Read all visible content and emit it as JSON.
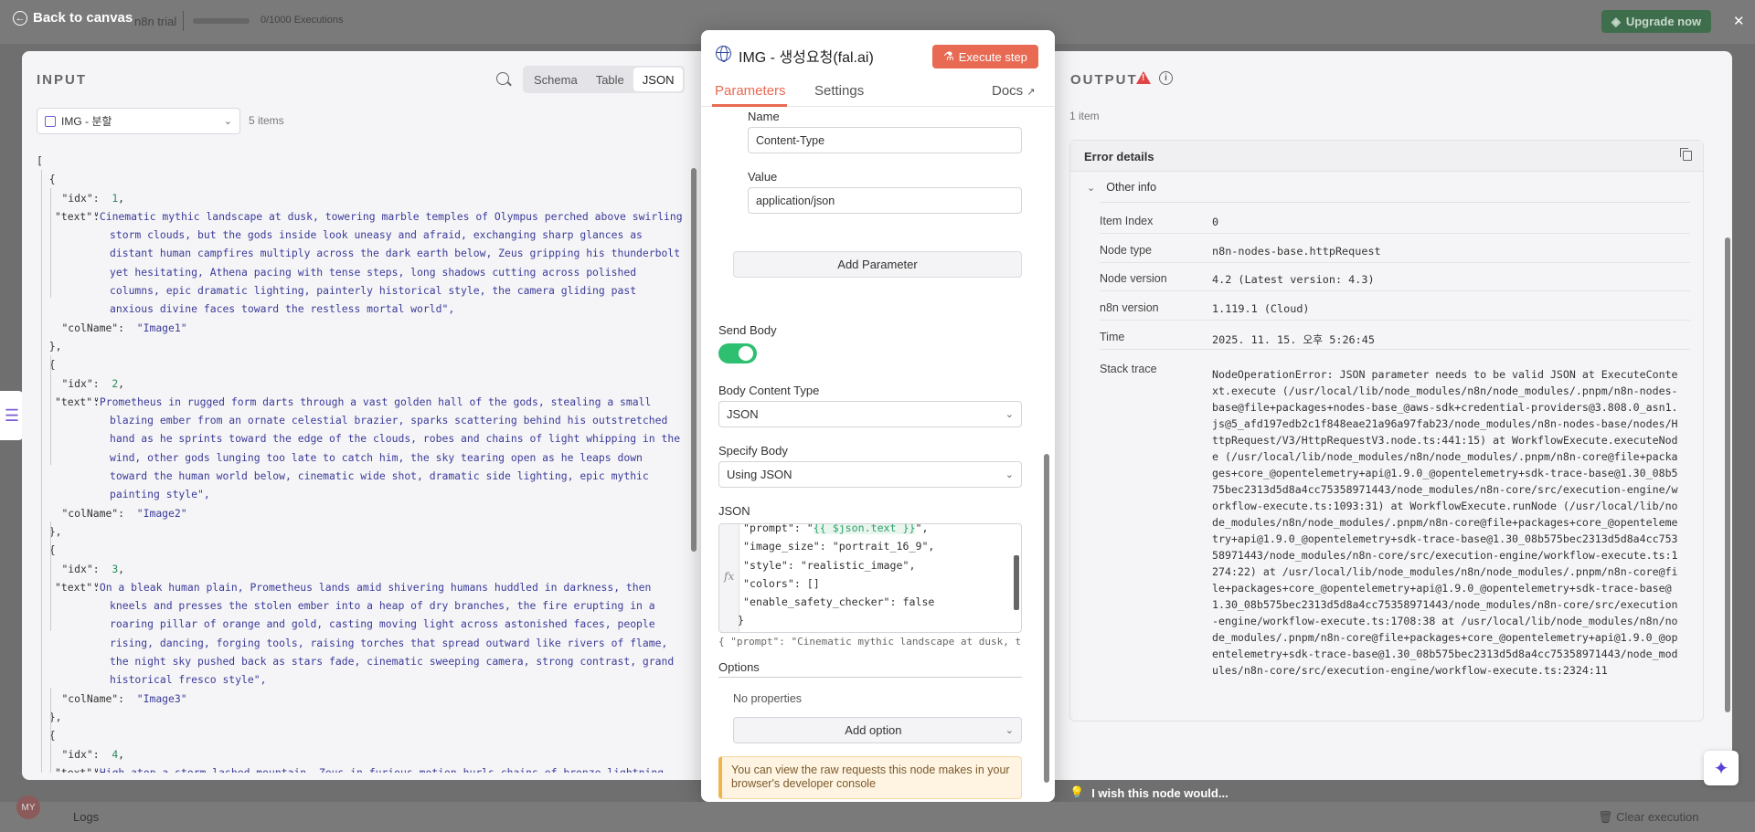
{
  "topbar": {
    "back_label": "Back to canvas",
    "trial_label": "n8n trial",
    "executions": "0/1000 Executions",
    "upgrade_label": "Upgrade now"
  },
  "bottombar": {
    "logs_label": "Logs",
    "clear_label": "Clear execution",
    "avatar_initials": "MY"
  },
  "input": {
    "title": "INPUT",
    "view_tabs": [
      "Schema",
      "Table",
      "JSON"
    ],
    "active_view": "JSON",
    "source_node": "IMG - 분할",
    "items_count": "5 items",
    "items": [
      {
        "idx": "1",
        "text": "\"Cinematic mythic landscape at dusk, towering marble temples of Olympus perched above swirling storm clouds, but the gods inside look uneasy and afraid, exchanging sharp glances as distant human campfires multiply across the dark earth below, Zeus gripping his thunderbolt yet hesitating, Athena pacing with tense steps, long shadows cutting across polished columns, epic dramatic lighting, painterly historical style, the camera gliding past anxious divine faces toward the restless mortal world\",",
        "colName": "\"Image1\""
      },
      {
        "idx": "2",
        "text": "\"Prometheus in rugged form darts through a vast golden hall of the gods, stealing a small blazing ember from an ornate celestial brazier, sparks scattering behind his outstretched hand as he sprints toward the edge of the clouds, robes and chains of light whipping in the wind, other gods lunging too late to catch him, the sky tearing open as he leaps down toward the human world below, cinematic wide shot, dramatic side lighting, epic mythic painting style\",",
        "colName": "\"Image2\""
      },
      {
        "idx": "3",
        "text": "\"On a bleak human plain, Prometheus lands amid shivering humans huddled in darkness, then kneels and presses the stolen ember into a heap of dry branches, the fire erupting in a roaring pillar of orange and gold, casting moving light across astonished faces, people rising, dancing, forging tools, raising torches that spread outward like rivers of flame, the night sky pushed back as stars fade, cinematic sweeping camera, strong contrast, grand historical fresco style\",",
        "colName": "\"Image3\""
      },
      {
        "idx": "4",
        "text": "\"High atop a storm lashed mountain, Zeus in furious motion hurls chains of bronze lightning that lash around Prometheus, pinning him to a jagged cliff face, the wind tearing his hair and garments, an enormous eagle diving from thunderclouds with wings spread wide, claws striking his",
        "colName": ""
      }
    ]
  },
  "node": {
    "title": "IMG - 생성요청(fal.ai)",
    "execute_label": "Execute step",
    "tabs": [
      "Parameters",
      "Settings"
    ],
    "docs_label": "Docs",
    "header_name_label": "Name",
    "header_name_value": "Content-Type",
    "header_value_label": "Value",
    "header_value_value": "application/json",
    "add_parameter": "Add Parameter",
    "send_body_label": "Send Body",
    "send_body_on": true,
    "body_content_type_label": "Body Content Type",
    "body_content_type": "JSON",
    "specify_body_label": "Specify Body",
    "specify_body": "Using JSON",
    "json_label": "JSON",
    "json_lines": [
      "\"prompt\": \"{{ $json.text }}\",",
      "\"image_size\": \"portrait_16_9\",",
      "\"style\": \"realistic_image\",",
      "\"colors\": []",
      "\"enable_safety_checker\": false",
      "}"
    ],
    "json_preview": "{   \"prompt\": \"Cinematic mythic landscape at dusk, to…",
    "options_label": "Options",
    "no_properties": "No properties",
    "add_option": "Add option",
    "notice": "You can view the raw requests this node makes in your browser's developer console"
  },
  "output": {
    "title": "OUTPUT",
    "count": "1 item",
    "error_title": "Error details",
    "other_info": "Other info",
    "rows": [
      {
        "label": "Item Index",
        "value": "0"
      },
      {
        "label": "Node type",
        "value": "n8n-nodes-base.httpRequest"
      },
      {
        "label": "Node version",
        "value": "4.2 (Latest version: 4.3)"
      },
      {
        "label": "n8n version",
        "value": "1.119.1 (Cloud)"
      },
      {
        "label": "Time",
        "value": "2025. 11. 15. 오후 5:26:45"
      }
    ],
    "stack_label": "Stack trace",
    "stack_trace": "NodeOperationError: JSON parameter needs to be valid JSON at ExecuteContext.execute (/usr/local/lib/node_modules/n8n/node_modules/.pnpm/n8n-nodes-base@file+packages+nodes-base_@aws-sdk+credential-providers@3.808.0_asn1.js@5_afd197edb2c1f848eae21a96a97fab23/node_modules/n8n-nodes-base/nodes/HttpRequest/V3/HttpRequestV3.node.ts:441:15) at WorkflowExecute.executeNode (/usr/local/lib/node_modules/n8n/node_modules/.pnpm/n8n-core@file+packages+core_@opentelemetry+api@1.9.0_@opentelemetry+sdk-trace-base@1.30_08b575bec2313d5d8a4cc75358971443/node_modules/n8n-core/src/execution-engine/workflow-execute.ts:1093:31) at WorkflowExecute.runNode (/usr/local/lib/node_modules/n8n/node_modules/.pnpm/n8n-core@file+packages+core_@opentelemetry+api@1.9.0_@opentelemetry+sdk-trace-base@1.30_08b575bec2313d5d8a4cc75358971443/node_modules/n8n-core/src/execution-engine/workflow-execute.ts:1274:22) at /usr/local/lib/node_modules/n8n/node_modules/.pnpm/n8n-core@file+packages+core_@opentelemetry+api@1.9.0_@opentelemetry+sdk-trace-base@1.30_08b575bec2313d5d8a4cc75358971443/node_modules/n8n-core/src/execution-engine/workflow-execute.ts:1708:38 at /usr/local/lib/node_modules/n8n/node_modules/.pnpm/n8n-core@file+packages+core_@opentelemetry+api@1.9.0_@opentelemetry+sdk-trace-base@1.30_08b575bec2313d5d8a4cc75358971443/node_modules/n8n-core/src/execution-engine/workflow-execute.ts:2324:11"
  },
  "feedback": {
    "wish_label": "I wish this node would..."
  },
  "colors": {
    "accent": "#e86a53",
    "toggle_on": "#2fbf71",
    "error": "#e04444"
  }
}
